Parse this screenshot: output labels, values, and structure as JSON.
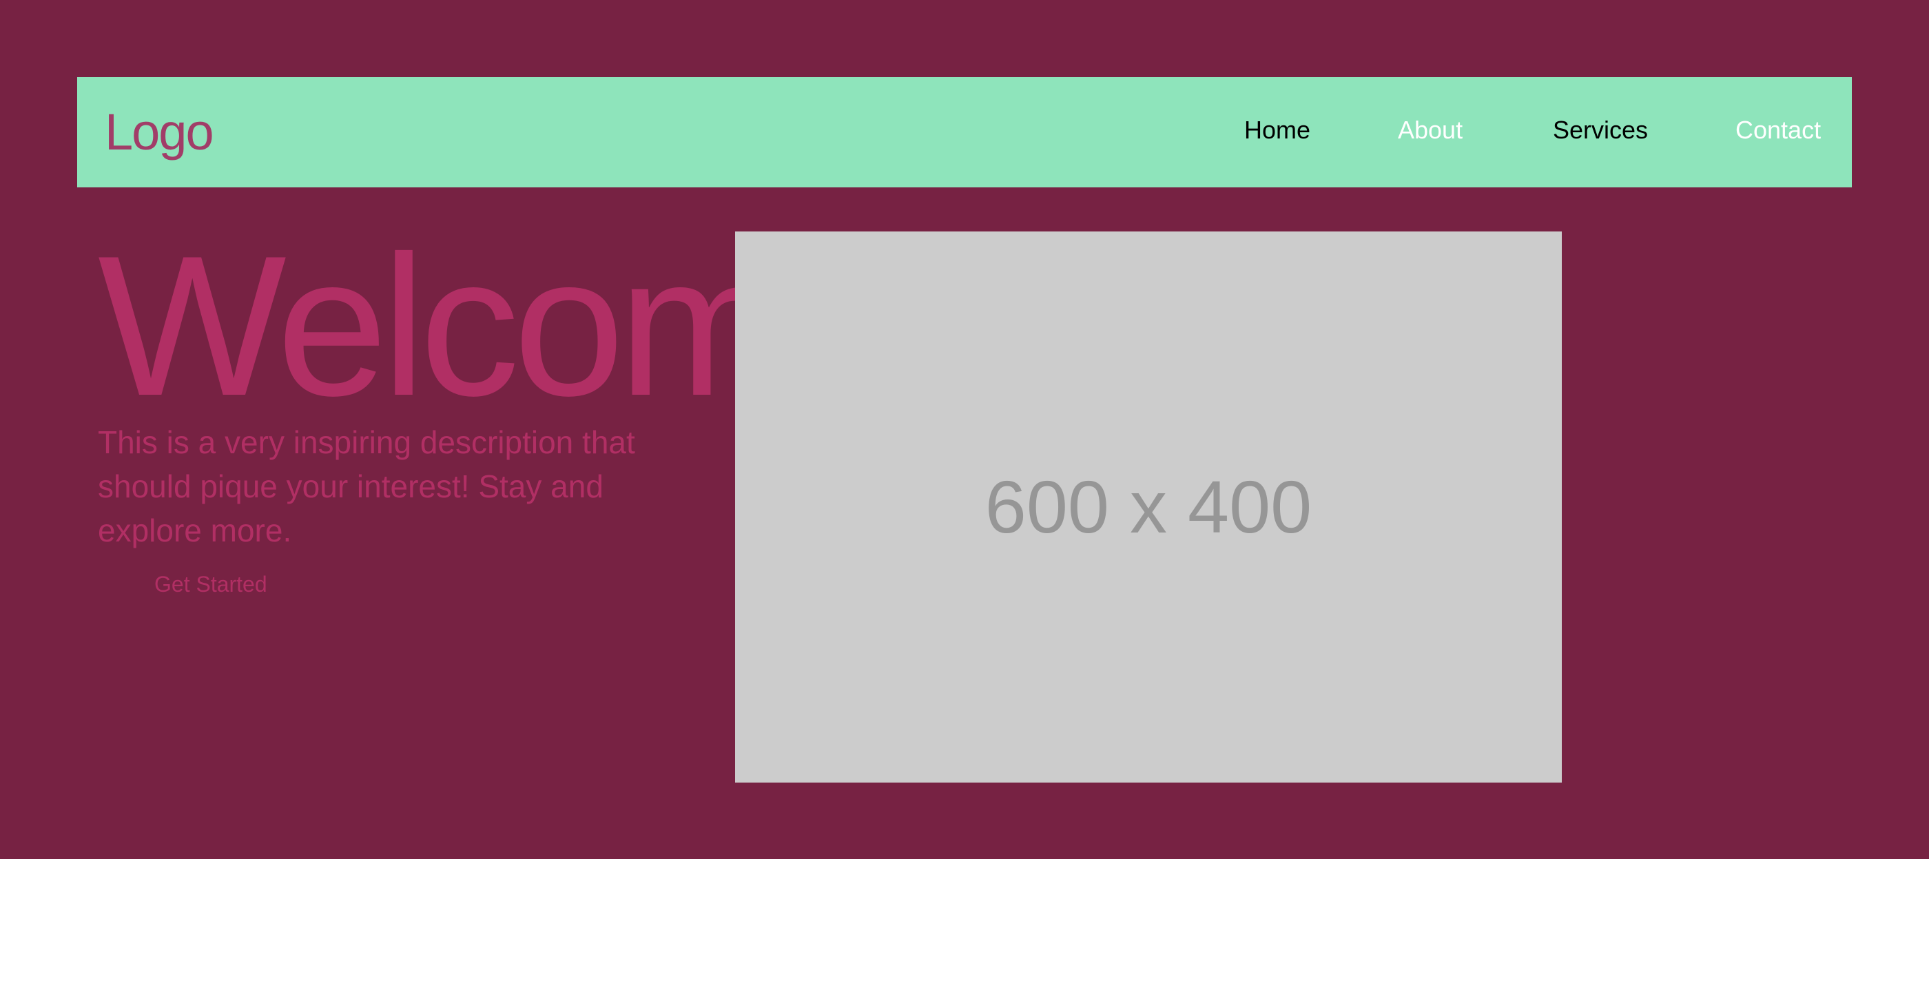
{
  "header": {
    "logo": "Logo",
    "nav": [
      {
        "label": "Home"
      },
      {
        "label": "About"
      },
      {
        "label": "Services"
      },
      {
        "label": "Contact"
      }
    ]
  },
  "hero": {
    "title": "Welcome",
    "description": "This is a very inspiring description that should pique your interest! Stay and explore more.",
    "cta_label": "Get Started",
    "image_placeholder": "600 x 400"
  },
  "colors": {
    "hero_background": "#772243",
    "navbar_background": "#8ee4bb",
    "accent_text": "#b12f64",
    "logo_text": "#a13d68",
    "placeholder_background": "#cccccc",
    "placeholder_text": "#969696"
  }
}
